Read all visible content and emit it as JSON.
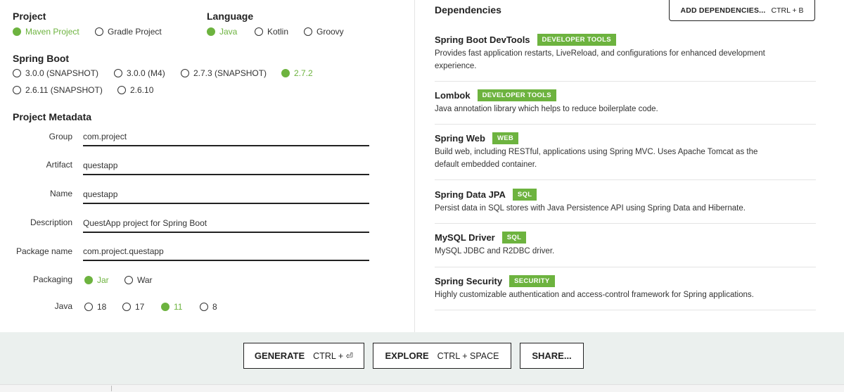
{
  "project": {
    "title": "Project",
    "options": [
      {
        "label": "Maven Project",
        "selected": true
      },
      {
        "label": "Gradle Project",
        "selected": false
      }
    ]
  },
  "language": {
    "title": "Language",
    "options": [
      {
        "label": "Java",
        "selected": true
      },
      {
        "label": "Kotlin",
        "selected": false
      },
      {
        "label": "Groovy",
        "selected": false
      }
    ]
  },
  "spring_boot": {
    "title": "Spring Boot",
    "options": [
      {
        "label": "3.0.0 (SNAPSHOT)",
        "selected": false
      },
      {
        "label": "3.0.0 (M4)",
        "selected": false
      },
      {
        "label": "2.7.3 (SNAPSHOT)",
        "selected": false
      },
      {
        "label": "2.7.2",
        "selected": true
      },
      {
        "label": "2.6.11 (SNAPSHOT)",
        "selected": false
      },
      {
        "label": "2.6.10",
        "selected": false
      }
    ]
  },
  "metadata": {
    "title": "Project Metadata",
    "fields": [
      {
        "label": "Group",
        "value": "com.project"
      },
      {
        "label": "Artifact",
        "value": "questapp"
      },
      {
        "label": "Name",
        "value": "questapp"
      },
      {
        "label": "Description",
        "value": "QuestApp project for Spring Boot"
      },
      {
        "label": "Package name",
        "value": "com.project.questapp"
      }
    ],
    "packaging": {
      "label": "Packaging",
      "options": [
        {
          "label": "Jar",
          "selected": true
        },
        {
          "label": "War",
          "selected": false
        }
      ]
    },
    "java": {
      "label": "Java",
      "options": [
        {
          "label": "18",
          "selected": false
        },
        {
          "label": "17",
          "selected": false
        },
        {
          "label": "11",
          "selected": true
        },
        {
          "label": "8",
          "selected": false
        }
      ]
    }
  },
  "dependencies": {
    "title": "Dependencies",
    "add_button": {
      "label": "ADD DEPENDENCIES...",
      "shortcut": "CTRL + B"
    },
    "items": [
      {
        "name": "Spring Boot DevTools",
        "badge": "DEVELOPER TOOLS",
        "description": "Provides fast application restarts, LiveReload, and configurations for enhanced development experience."
      },
      {
        "name": "Lombok",
        "badge": "DEVELOPER TOOLS",
        "description": "Java annotation library which helps to reduce boilerplate code."
      },
      {
        "name": "Spring Web",
        "badge": "WEB",
        "description": "Build web, including RESTful, applications using Spring MVC. Uses Apache Tomcat as the default embedded container."
      },
      {
        "name": "Spring Data JPA",
        "badge": "SQL",
        "description": "Persist data in SQL stores with Java Persistence API using Spring Data and Hibernate."
      },
      {
        "name": "MySQL Driver",
        "badge": "SQL",
        "description": "MySQL JDBC and R2DBC driver."
      },
      {
        "name": "Spring Security",
        "badge": "SECURITY",
        "description": "Highly customizable authentication and access-control framework for Spring applications."
      }
    ]
  },
  "footer": {
    "generate": {
      "label": "GENERATE",
      "shortcut": "CTRL + ⏎"
    },
    "explore": {
      "label": "EXPLORE",
      "shortcut": "CTRL + SPACE"
    },
    "share": {
      "label": "SHARE..."
    }
  },
  "colors": {
    "accent": "#6db33f",
    "footer_bg": "#ebf0ee"
  }
}
